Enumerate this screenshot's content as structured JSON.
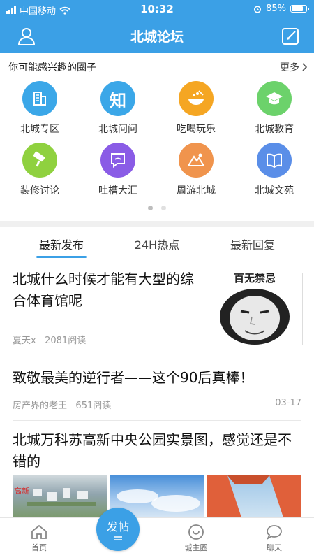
{
  "status_bar": {
    "carrier": "中国移动",
    "time": "10:32",
    "battery": "85%",
    "battery_level": 0.85
  },
  "nav": {
    "title": "北城论坛",
    "left_icon": "user-icon",
    "right_icon": "edit-icon"
  },
  "circles": {
    "heading": "你可能感兴趣的圈子",
    "more": "更多",
    "items": [
      {
        "label": "北城专区",
        "icon": "building-icon",
        "color": "#3ba7e8"
      },
      {
        "label": "北城问问",
        "icon": "zhi-text-icon",
        "glyph": "知",
        "color": "#3ba7e8"
      },
      {
        "label": "吃喝玩乐",
        "icon": "food-bowl-icon",
        "color": "#f5a623"
      },
      {
        "label": "北城教育",
        "icon": "graduation-cap-icon",
        "color": "#6cd26b"
      },
      {
        "label": "装修讨论",
        "icon": "paint-roller-icon",
        "color": "#8fd13f"
      },
      {
        "label": "吐槽大汇",
        "icon": "chat-bubble-icon",
        "color": "#8a5ce6"
      },
      {
        "label": "周游北城",
        "icon": "mountain-icon",
        "color": "#f0944d"
      },
      {
        "label": "北城文苑",
        "icon": "book-icon",
        "color": "#5a8ee8"
      }
    ],
    "page_indicator": {
      "pages": 2,
      "current": 1
    }
  },
  "tabs": [
    "最新发布",
    "24H热点",
    "最新回复"
  ],
  "active_tab": 0,
  "posts": [
    {
      "title": "北城什么时候才能有大型的综合体育馆呢",
      "author": "夏天x",
      "reads": "2081阅读",
      "date": "",
      "thumb_text": "百无禁忌"
    },
    {
      "title": "致敬最美的逆行者——这个90后真棒！",
      "author": "房产界的老王",
      "reads": "651阅读",
      "date": "03-17"
    },
    {
      "title": "北城万科苏高新中央公园实景图，感觉还是不错的",
      "author": "",
      "reads": "",
      "date": "",
      "pic_caption": "高新"
    }
  ],
  "tabbar": {
    "items": [
      {
        "label": "首页",
        "icon": "home-icon"
      },
      {
        "label": "城主圈",
        "icon": "circle-chat-icon"
      },
      {
        "label": "聊天",
        "icon": "speech-bubble-icon"
      }
    ],
    "post_button": "发帖"
  },
  "colors": {
    "primary": "#3ba0e6"
  }
}
